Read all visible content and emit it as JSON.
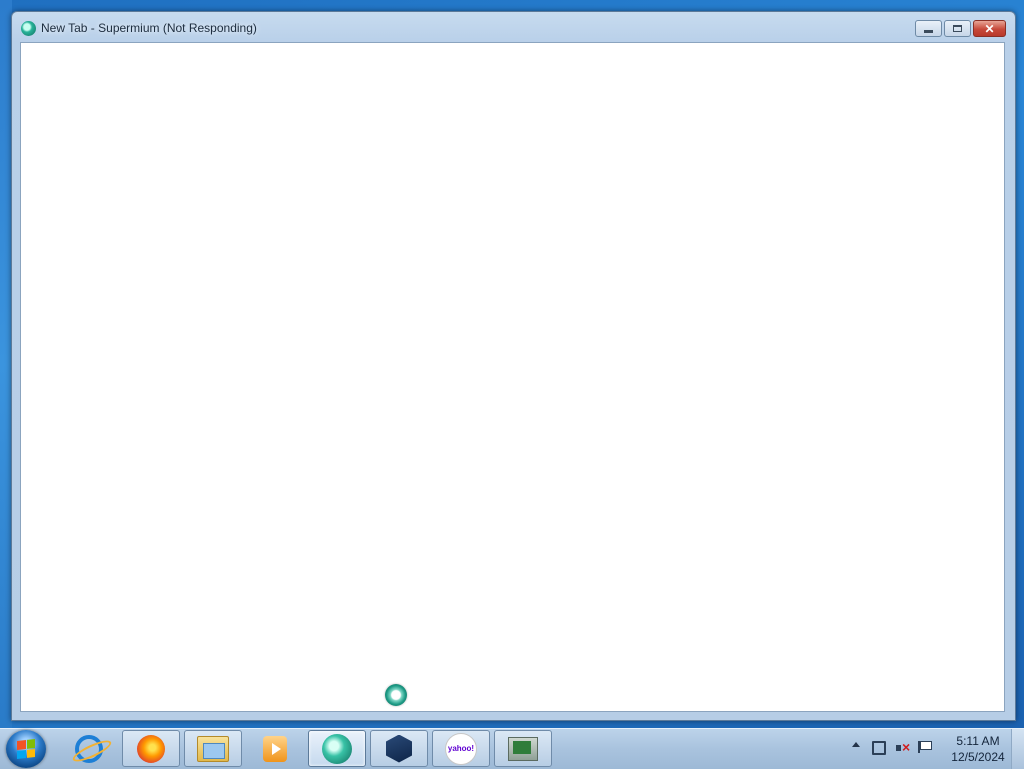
{
  "window": {
    "title": "New Tab - Supermium (Not Responding)",
    "icon": "supermium-icon",
    "controls": {
      "minimize_icon": "minimize-icon",
      "maximize_icon": "maximize-icon",
      "close_icon": "close-icon",
      "close_color": "#c7493a"
    },
    "content_state": "blank"
  },
  "cursor": {
    "type": "busy",
    "icon": "busy-spinner-icon"
  },
  "taskbar": {
    "pinned": [
      {
        "name": "Internet Explorer",
        "icon": "internet-explorer-icon",
        "framed": false
      },
      {
        "name": "Firefox",
        "icon": "firefox-icon",
        "framed": true
      },
      {
        "name": "File Explorer",
        "icon": "file-explorer-icon",
        "framed": true
      },
      {
        "name": "Media Player",
        "icon": "media-player-icon",
        "framed": false
      },
      {
        "name": "Supermium",
        "icon": "supermium-icon",
        "framed": true,
        "active": true
      },
      {
        "name": "VirtualBox",
        "icon": "virtualbox-icon",
        "framed": true
      },
      {
        "name": "Yahoo",
        "icon": "yahoo-icon",
        "label": "yahoo!",
        "framed": true
      },
      {
        "name": "Monitor",
        "icon": "monitor-icon",
        "framed": true
      }
    ],
    "tray": {
      "icons": [
        "show-hidden-icons-icon",
        "network-icon",
        "volume-muted-icon",
        "action-center-flag-icon"
      ],
      "time": "5:11 AM",
      "date": "12/5/2024"
    }
  }
}
